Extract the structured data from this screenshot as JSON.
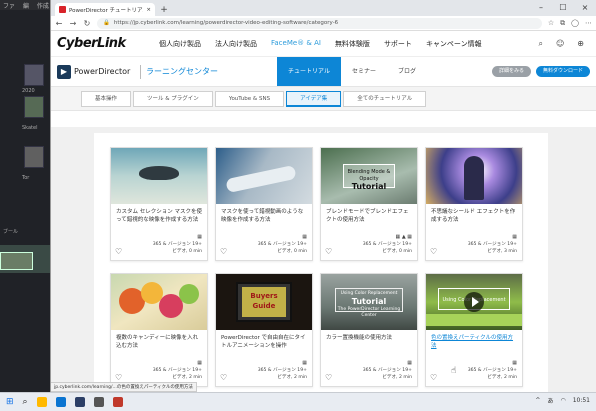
{
  "background_app": {
    "menu": [
      "ファ",
      "編",
      "作成",
      "ル"
    ],
    "labels": [
      "2020",
      "Skatel",
      "Tor",
      "ブール"
    ]
  },
  "browser": {
    "tab_title": "PowerDirector チュートリアル | Cyb…",
    "tab_close": "×",
    "new_tab": "+",
    "window_controls": [
      "–",
      "☐",
      "×"
    ],
    "url": "https://jp.cyberlink.com/learning/powerdirector-video-editing-software/category-6",
    "status_link": "jp.cyberlink.com/learning/...の色の置換えパーティクルの使用方法"
  },
  "site_header": {
    "logo": "CyberLink",
    "nav": [
      "個人向け製品",
      "法人向け製品",
      "FaceMe® & AI",
      "無料体験版",
      "サポート",
      "キャンペーン情報"
    ]
  },
  "sub_header": {
    "product": "PowerDirector",
    "section": "ラーニングセンター",
    "nav": [
      "チュートリアル",
      "セミナー",
      "ブログ"
    ],
    "active_nav": "チュートリアル",
    "btn_details": "詳細をみる",
    "btn_download": "無料ダウンロード"
  },
  "categories": {
    "items": [
      "基本操作",
      "ツール & プラグイン",
      "YouTube & SNS",
      "アイデア集",
      "全てのチュートリアル"
    ],
    "active": "アイデア集"
  },
  "cards": [
    {
      "title": "カスタム セレクション マスクを使って錯視的な映像を作成する方法",
      "version": "365 & バージョン 19+",
      "meta": "ビデオ, 0 min",
      "link": false
    },
    {
      "title": "マスクを使って錯視動画のような映像を作成する方法",
      "version": "365 & バージョン 19+",
      "meta": "ビデオ, 0 min",
      "link": false
    },
    {
      "title": "ブレンドモードでブレンドエフェクトの使用方法",
      "version": "365 & バージョン 19+",
      "meta": "ビデオ, 0 min",
      "link": false
    },
    {
      "title": "不思議なシールド エフェクトを作成する方法",
      "version": "365 & バージョン 19+",
      "meta": "ビデオ, 3 min",
      "link": false
    },
    {
      "title": "複数のキャンディーに映像を入れ込む方法",
      "version": "365 & バージョン 19+",
      "meta": "ビデオ, 2 min",
      "link": false
    },
    {
      "title": "PowerDirector で自由自在にタイトルアニメーションを操作",
      "version": "365 & バージョン 19+",
      "meta": "ビデオ, 2 min",
      "link": false
    },
    {
      "title": "カラー置換機能の使用方法",
      "version": "365 & バージョン 19+",
      "meta": "ビデオ, 2 min",
      "link": false
    },
    {
      "title": "色の置換えパーティクルの使用方法",
      "version": "365 & バージョン 19+",
      "meta": "ビデオ, 2 min",
      "link": true
    }
  ],
  "thumb_text": {
    "c3_small": "Blending Mode & Opacity",
    "c3_big": "Tutorial",
    "c6_big": "Buyers Guide",
    "c7_small": "Using Color Replacement",
    "c7_big": "Tutorial",
    "c7_sub": "The PowerDirector Learning Center",
    "c8": "Using Color Replacement"
  },
  "taskbar": {
    "time": "10:51",
    "lang": "あ"
  }
}
